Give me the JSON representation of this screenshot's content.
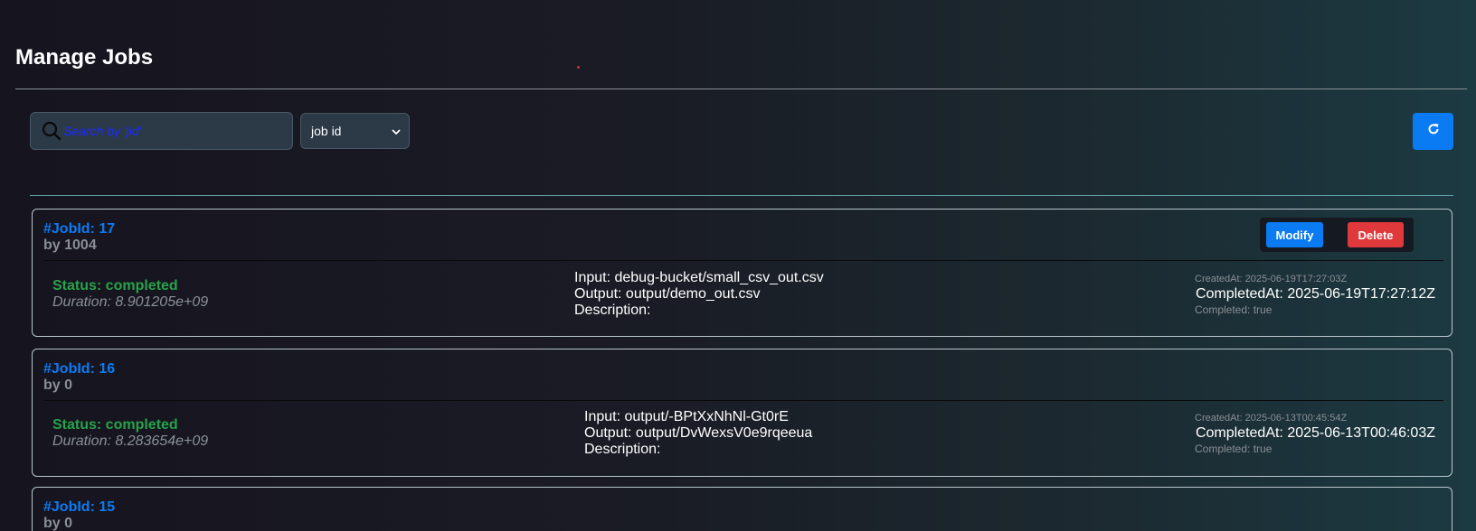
{
  "page": {
    "title": "Manage Jobs"
  },
  "toolbar": {
    "search_placeholder": "Search by 'jid'",
    "search_icon": "search-icon",
    "filter_selected": "job id",
    "refresh_icon": "refresh-icon"
  },
  "actions": {
    "modify_label": "Modify",
    "delete_label": "Delete"
  },
  "jobs": [
    {
      "id": "#JobId: 17",
      "owner": "by 1004",
      "status": "Status: completed",
      "duration": "Duration: 8.901205e+09",
      "input": "Input: debug-bucket/small_csv_out.csv",
      "output": "Output: output/demo_out.csv",
      "description": "Description:",
      "created_at": "CreatedAt: 2025-06-19T17:27:03Z",
      "completed_at": "CompletedAt: 2025-06-19T17:27:12Z",
      "completed": "Completed: true"
    },
    {
      "id": "#JobId: 16",
      "owner": "by 0",
      "status": "Status: completed",
      "duration": "Duration: 8.283654e+09",
      "input": "Input: output/-BPtXxNhNl-Gt0rE",
      "output": "Output: output/DvWexsV0e9rqeeua",
      "description": "Description:",
      "created_at": "CreatedAt: 2025-06-13T00:45:54Z",
      "completed_at": "CompletedAt: 2025-06-13T00:46:03Z",
      "completed": "Completed: true"
    },
    {
      "id": "#JobId: 15",
      "owner": "by 0"
    }
  ],
  "colors": {
    "accent": "#0b7bf4",
    "danger": "#e0393c",
    "success": "#27a34a",
    "muted": "#8a8f96"
  }
}
